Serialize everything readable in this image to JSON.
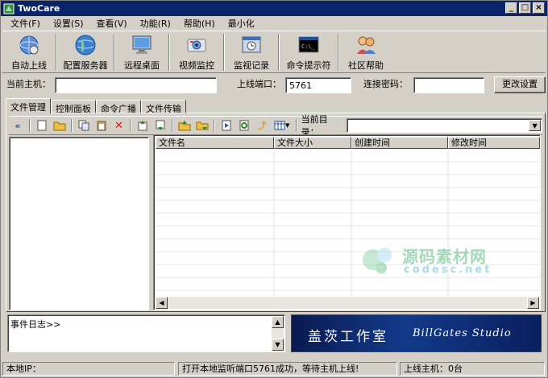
{
  "window": {
    "title": "TwoCare"
  },
  "menu": [
    "文件(F)",
    "设置(S)",
    "查看(V)",
    "功能(R)",
    "帮助(H)",
    "最小化"
  ],
  "toolbar": [
    {
      "label": "自动上线",
      "icon": "auto-online-icon"
    },
    {
      "label": "配置服务器",
      "icon": "config-server-icon"
    },
    {
      "label": "远程桌面",
      "icon": "remote-desktop-icon"
    },
    {
      "label": "视频监控",
      "icon": "video-monitor-icon"
    },
    {
      "label": "监视记录",
      "icon": "monitor-log-icon"
    },
    {
      "label": "命令提示符",
      "icon": "command-prompt-icon"
    },
    {
      "label": "社区帮助",
      "icon": "community-help-icon"
    }
  ],
  "host": {
    "current_host_label": "当前主机：",
    "current_host_value": "",
    "port_label": "上线端口：",
    "port_value": "5761",
    "password_label": "连接密码：",
    "password_value": "",
    "change_button": "更改设置"
  },
  "tabs": [
    "文件管理",
    "控制面板",
    "命令广播",
    "文件传输"
  ],
  "file_manager": {
    "current_dir_label": "当前目录：",
    "current_dir_value": "",
    "columns": [
      "文件名",
      "文件大小",
      "创建时间",
      "修改时间"
    ]
  },
  "log": {
    "text": "事件日志>>"
  },
  "banner": {
    "cn": "盖茨工作室",
    "en": "BillGates Studio"
  },
  "watermark": {
    "cn": "源码素材网",
    "en": "codesc.net"
  },
  "status": {
    "local_ip": "本地IP：",
    "message": "打开本地监听端口5761成功，等待主机上线!",
    "online_hosts": "上线主机：0台"
  },
  "colors": {
    "titlebar": "#0a246a",
    "face": "#d4d0c8",
    "banner": "#123a8a"
  }
}
